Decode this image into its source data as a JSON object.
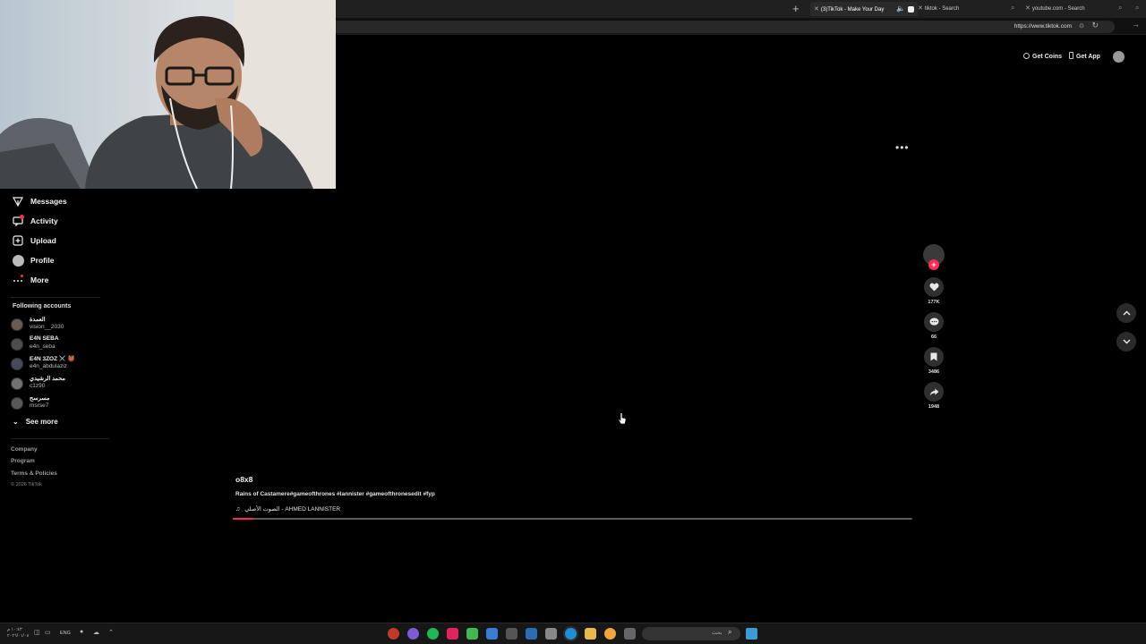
{
  "browser": {
    "tabs": [
      {
        "label": "(3)TikTok - Make Your Day",
        "active": true
      },
      {
        "label": "tiktok - Search",
        "active": false
      },
      {
        "label": "youtube.com - Search",
        "active": false
      }
    ],
    "url": "https://www.tiktok.com"
  },
  "header": {
    "get_coins": "Get Coins",
    "get_app": "Get App"
  },
  "sidebar": {
    "nav": [
      {
        "label": "Messages",
        "icon": "messages-icon"
      },
      {
        "label": "Activity",
        "icon": "activity-icon"
      },
      {
        "label": "Upload",
        "icon": "upload-icon"
      },
      {
        "label": "Profile",
        "icon": "profile-icon"
      },
      {
        "label": "More",
        "icon": "more-icon"
      }
    ],
    "following_title": "Following accounts",
    "accounts": [
      {
        "name": "العمدة",
        "username": "vision__2030"
      },
      {
        "name": "E4N SEBA",
        "username": "e4n_seba"
      },
      {
        "name": "E4N 3ZOZ ⚔️ 👹",
        "username": "e4n_abdulaziz"
      },
      {
        "name": "محمد الرشيدي",
        "username": "c1z90"
      },
      {
        "name": "مسرسح",
        "username": "msrse7"
      }
    ],
    "see_more": "See more",
    "footer": [
      "Company",
      "Program",
      "Terms & Policies"
    ],
    "copyright": "© 2026 TikTok"
  },
  "video": {
    "author": "o8x8",
    "caption": "Rains of Castamere#gameofthrones #lannister #gameofthronesedit #fyp",
    "sound": "الصوت الأصلي - AHMED LANNISTER",
    "progress": 0.03,
    "likes": "177K",
    "comments": "66",
    "saves": "3486",
    "shares": "1948"
  },
  "taskbar": {
    "time": "١٠:٤٣ م",
    "date": "٢٠٢٦/٠١/٠٨",
    "lang": "ENG",
    "search_placeholder": "بحث"
  },
  "colors": {
    "accent": "#fe2c55",
    "background": "#000000",
    "surface": "#2f2f2f"
  }
}
